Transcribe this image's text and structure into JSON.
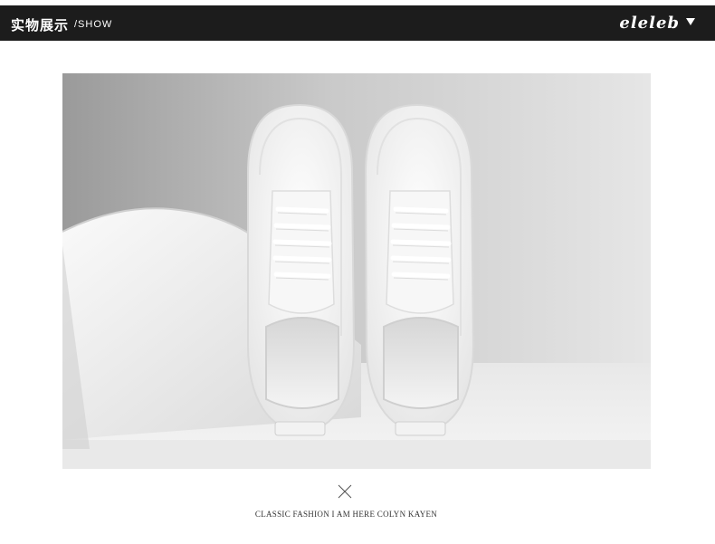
{
  "header": {
    "title": "实物展示",
    "subtitle": "/SHOW",
    "brand": "eleleb",
    "menu_icon": "triangle-down-icon"
  },
  "photo": {
    "subject": "pair-of-white-sneakers-icon"
  },
  "divider_icon": "x-cross-icon",
  "caption": "CLASSIC FASHION I AM HERE COLYN KAYEN",
  "colors": {
    "header_bg": "#1c1c1c",
    "header_text": "#ffffff",
    "page_bg": "#ffffff"
  }
}
